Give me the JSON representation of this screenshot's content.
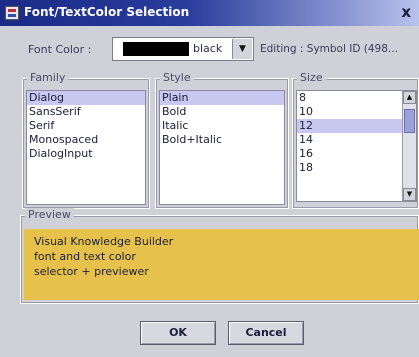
{
  "window": {
    "title": "Font/TextColor Selection",
    "close_glyph": "x"
  },
  "font_color": {
    "label": "Font Color :",
    "value": "black",
    "swatch_color": "#000000",
    "arrow_glyph": "▼"
  },
  "editing": {
    "text": "Editing : Symbol ID (498..."
  },
  "family": {
    "label": "Family",
    "items": [
      "Dialog",
      "SansSerif",
      "Serif",
      "Monospaced",
      "DialogInput"
    ],
    "selected": "Dialog"
  },
  "style": {
    "label": "Style",
    "items": [
      "Plain",
      "Bold",
      "Italic",
      "Bold+Italic"
    ],
    "selected": "Plain"
  },
  "size": {
    "label": "Size",
    "items": [
      "8",
      "10",
      "12",
      "14",
      "16",
      "18"
    ],
    "selected": "12"
  },
  "preview": {
    "label": "Preview",
    "lines": [
      "Visual Knowledge Builder",
      "font and text color",
      "selector + previewer"
    ],
    "background_color": "#e6c24c"
  },
  "buttons": {
    "ok": "OK",
    "cancel": "Cancel"
  },
  "colors": {
    "title_bar": "#1a2a86",
    "selection": "#c8c8f0",
    "window_bg": "#d0d0d8"
  }
}
